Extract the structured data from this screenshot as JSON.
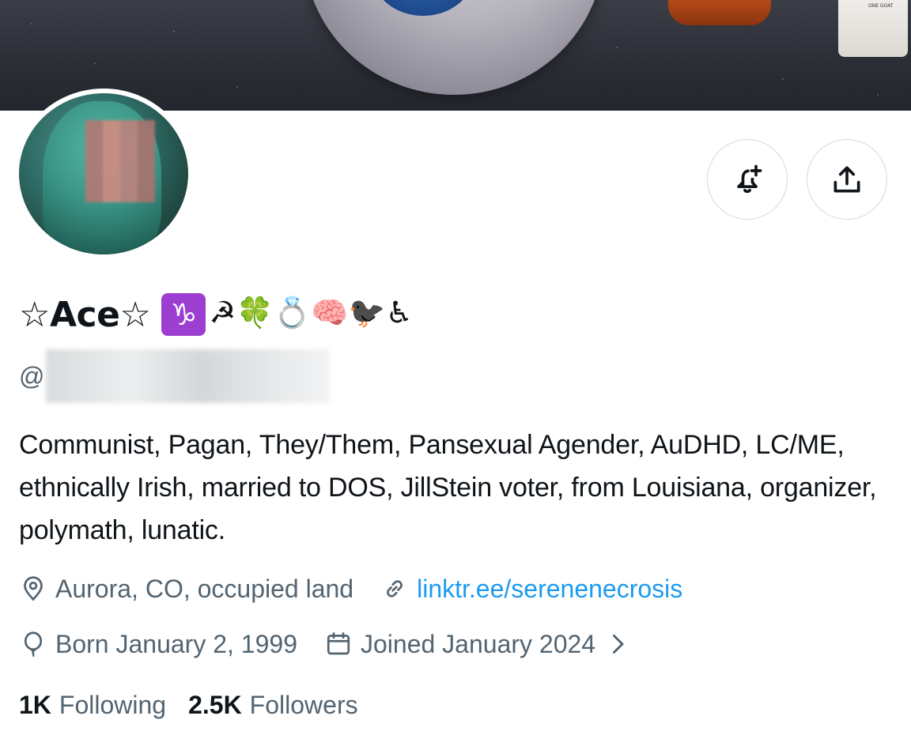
{
  "banner": {
    "carton_text": "ONE GOAT"
  },
  "actions": {
    "notify_icon": "bell-plus-icon",
    "share_icon": "share-icon"
  },
  "profile": {
    "display_name": "☆Ace☆",
    "zodiac": "♑",
    "name_emojis": "☭🍀💍🧠🐦‍⬛♿",
    "handle_prefix": "@",
    "bio": "Communist, Pagan, They/Them, Pansexual Agender, AuDHD, LC/ME, ethnically Irish, married to DOS, JillStein voter, from Louisiana, organizer, polymath, lunatic.",
    "location": "Aurora, CO, occupied land",
    "website": "linktr.ee/serenenecrosis",
    "born": "Born January 2, 1999",
    "joined": "Joined January 2024"
  },
  "stats": {
    "following_count": "1K",
    "following_label": "Following",
    "followers_count": "2.5K",
    "followers_label": "Followers"
  },
  "colors": {
    "link": "#1d9bf0",
    "secondary_text": "#536471",
    "primary_text": "#0f1419",
    "border": "#cfd9de"
  }
}
